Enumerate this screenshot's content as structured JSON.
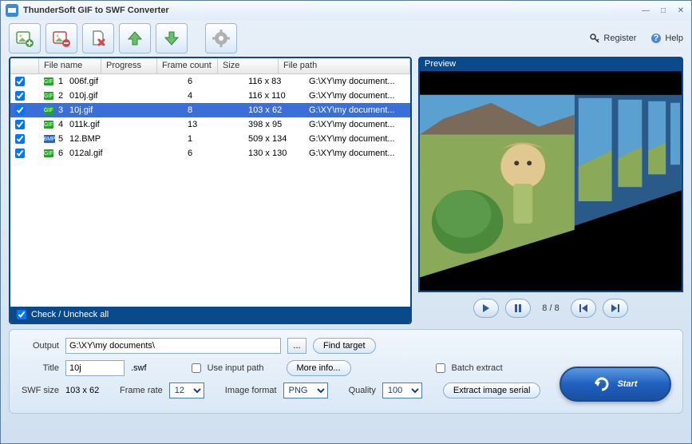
{
  "app": {
    "title": "ThunderSoft GIF to SWF Converter"
  },
  "toolbar": {
    "register": "Register",
    "help": "Help"
  },
  "table": {
    "headers": {
      "filename": "File name",
      "progress": "Progress",
      "framecount": "Frame count",
      "size": "Size",
      "filepath": "File path"
    },
    "rows": [
      {
        "idx": "1",
        "type": "gif",
        "name": "006f.gif",
        "progress": "",
        "frame": "6",
        "size": "116 x 83",
        "path": "G:\\XY\\my document...",
        "checked": true,
        "selected": false
      },
      {
        "idx": "2",
        "type": "gif",
        "name": "010j.gif",
        "progress": "",
        "frame": "4",
        "size": "116 x 110",
        "path": "G:\\XY\\my document...",
        "checked": true,
        "selected": false
      },
      {
        "idx": "3",
        "type": "gif",
        "name": "10j.gif",
        "progress": "",
        "frame": "8",
        "size": "103 x 62",
        "path": "G:\\XY\\my document...",
        "checked": true,
        "selected": true
      },
      {
        "idx": "4",
        "type": "gif",
        "name": "011k.gif",
        "progress": "",
        "frame": "13",
        "size": "398 x 95",
        "path": "G:\\XY\\my document...",
        "checked": true,
        "selected": false
      },
      {
        "idx": "5",
        "type": "bmp",
        "name": "12.BMP",
        "progress": "",
        "frame": "1",
        "size": "509 x 134",
        "path": "G:\\XY\\my document...",
        "checked": true,
        "selected": false
      },
      {
        "idx": "6",
        "type": "gif",
        "name": "012al.gif",
        "progress": "",
        "frame": "6",
        "size": "130 x 130",
        "path": "G:\\XY\\my document...",
        "checked": true,
        "selected": false
      }
    ],
    "check_all": "Check / Uncheck all"
  },
  "preview": {
    "label": "Preview",
    "counter": "8 / 8"
  },
  "output": {
    "output_label": "Output",
    "output_path": "G:\\XY\\my documents\\",
    "find_target": "Find target",
    "title_label": "Title",
    "title_value": "10j",
    "title_ext": ".swf",
    "use_input_path": "Use input path",
    "more_info": "More info...",
    "swf_size_label": "SWF size",
    "swf_size": "103 x 62",
    "frame_rate_label": "Frame rate",
    "frame_rate": "12",
    "image_format_label": "Image format",
    "image_format": "PNG",
    "quality_label": "Quality",
    "quality": "100",
    "batch_extract": "Batch extract",
    "extract_serial": "Extract image serial",
    "start": "Start"
  }
}
